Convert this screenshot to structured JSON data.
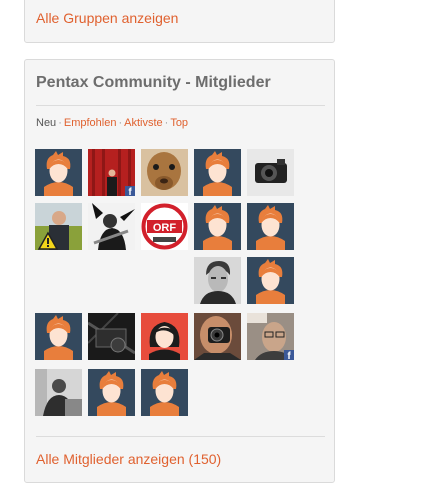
{
  "groups_panel": {
    "all_groups_link": "Alle Gruppen anzeigen"
  },
  "members_panel": {
    "title": "Pentax Community - Mitglieder",
    "filters": [
      {
        "label": "Neu",
        "active": true
      },
      {
        "label": "Empfohlen",
        "active": false
      },
      {
        "label": "Aktivste",
        "active": false
      },
      {
        "label": "Top",
        "active": false
      }
    ],
    "filter_separator": "·",
    "all_members_link": "Alle Mitglieder anzeigen (150)"
  },
  "members": [
    {
      "avatar": "default-avatar-icon"
    },
    {
      "avatar": "photo-man-red-curtain",
      "facebook_badge": true
    },
    {
      "avatar": "photo-alpaca"
    },
    {
      "avatar": "default-avatar-icon"
    },
    {
      "avatar": "photo-bw-camera"
    },
    {
      "avatar": "photo-man-warning-sign"
    },
    {
      "avatar": "photo-guitarist-bw"
    },
    {
      "avatar": "orf-logo",
      "logo_text": "ORF"
    },
    {
      "avatar": "default-avatar-icon"
    },
    {
      "avatar": "default-avatar-icon"
    },
    {
      "avatar": "photo-young-man-bw"
    },
    {
      "avatar": "default-avatar-icon"
    },
    {
      "avatar": "default-avatar-icon"
    },
    {
      "avatar": "photo-dark-machine"
    },
    {
      "avatar": "female-avatar-icon"
    },
    {
      "avatar": "photo-man-with-camera"
    },
    {
      "avatar": "photo-man-with-glasses",
      "facebook_badge": true
    },
    {
      "avatar": "photo-man-at-desk"
    },
    {
      "avatar": "default-avatar-icon"
    },
    {
      "avatar": "default-avatar-icon"
    }
  ],
  "colors": {
    "link": "#e0612f",
    "avatar_bg": "#34495e",
    "avatar_hair": "#e87e3c",
    "avatar_skin": "#fde3d2",
    "female_bg": "#e74c3c",
    "facebook": "#3b5998"
  }
}
